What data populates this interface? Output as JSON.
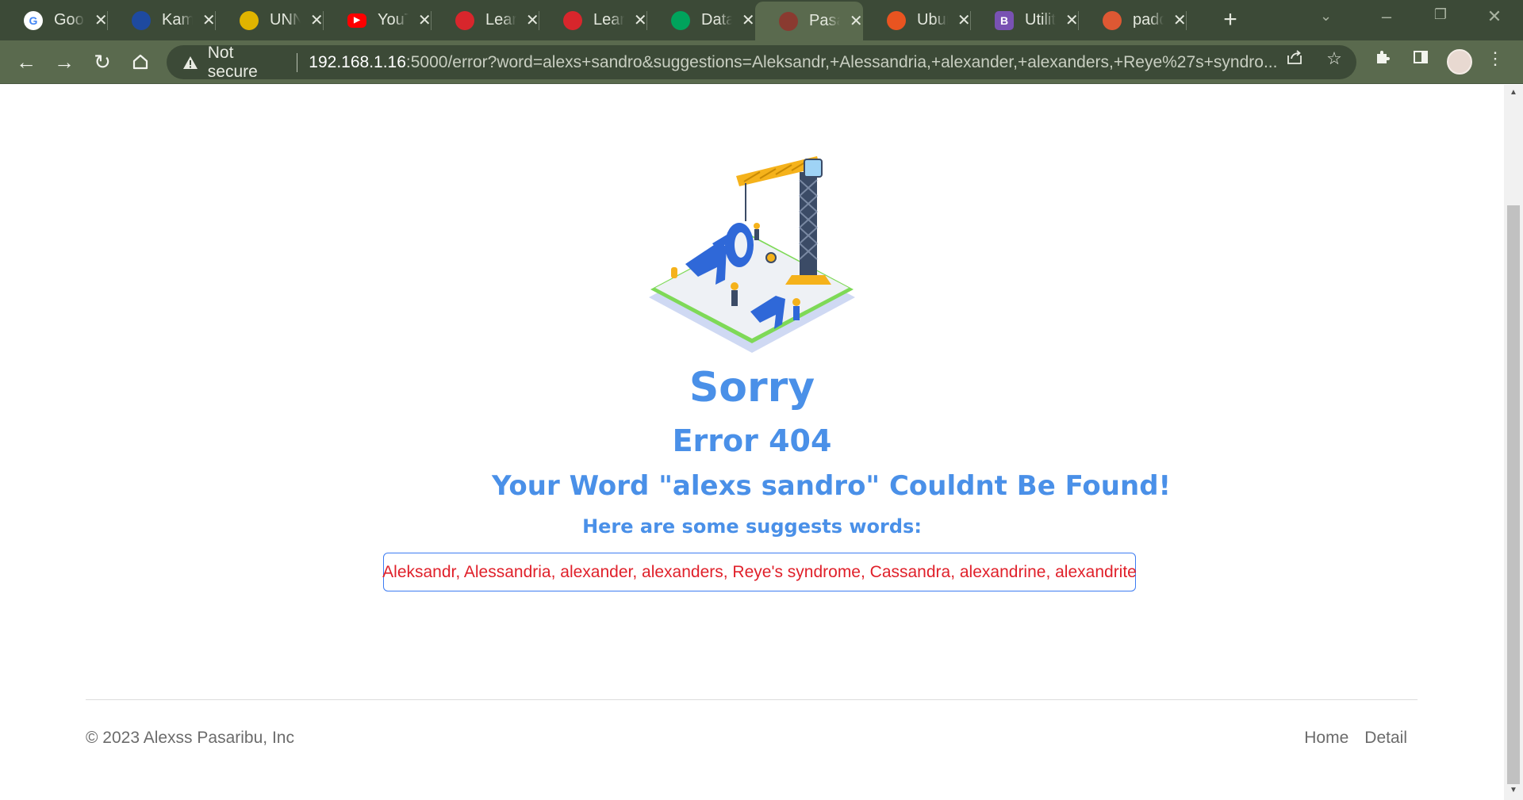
{
  "browser": {
    "tabs": [
      {
        "title": "Goog",
        "icon": "google-icon",
        "color": "#ffffff"
      },
      {
        "title": "Kamp",
        "icon": "kampus-icon",
        "color": "#1e4aa0"
      },
      {
        "title": "UNN",
        "icon": "unn-icon",
        "color": "#e0b400"
      },
      {
        "title": "YouT",
        "icon": "youtube-icon",
        "color": "#ff0000"
      },
      {
        "title": "Learn",
        "icon": "learn-icon",
        "color": "#d8262c"
      },
      {
        "title": "Learn",
        "icon": "learn-icon",
        "color": "#d8262c"
      },
      {
        "title": "Datal",
        "icon": "mongodb-icon",
        "color": "#00a35c"
      },
      {
        "title": "Pasar",
        "icon": "pasar-icon",
        "color": "#8a3a30"
      },
      {
        "title": "Ubun",
        "icon": "ubuntu-icon",
        "color": "#e95420"
      },
      {
        "title": "Utilit",
        "icon": "bootstrap-icon",
        "color": "#7952b3"
      },
      {
        "title": "padd",
        "icon": "duckduckgo-icon",
        "color": "#de5833"
      }
    ],
    "active_tab_index": 7,
    "address": {
      "security_label": "Not secure",
      "host": "192.168.1.16",
      "path": ":5000/error?word=alexs+sandro&suggestions=Aleksandr,+Alessandria,+alexander,+alexanders,+Reye%27s+syndro..."
    }
  },
  "page": {
    "heading": "Sorry",
    "error_code": "Error 404",
    "not_found_message": "Your Word \"alexs sandro\" Couldnt Be Found!",
    "suggest_label": "Here are some suggests words:",
    "suggestions": "Aleksandr, Alessandria, alexander, alexanders, Reye's syndrome, Cassandra, alexandrine, alexandrite"
  },
  "footer": {
    "copyright": "© 2023 Alexss Pasaribu, Inc",
    "links": [
      "Home",
      "Detail"
    ]
  },
  "colors": {
    "accent_blue": "#4a90e8",
    "suggestion_red": "#e0202a",
    "toolbar_green": "#5a6a4e"
  }
}
